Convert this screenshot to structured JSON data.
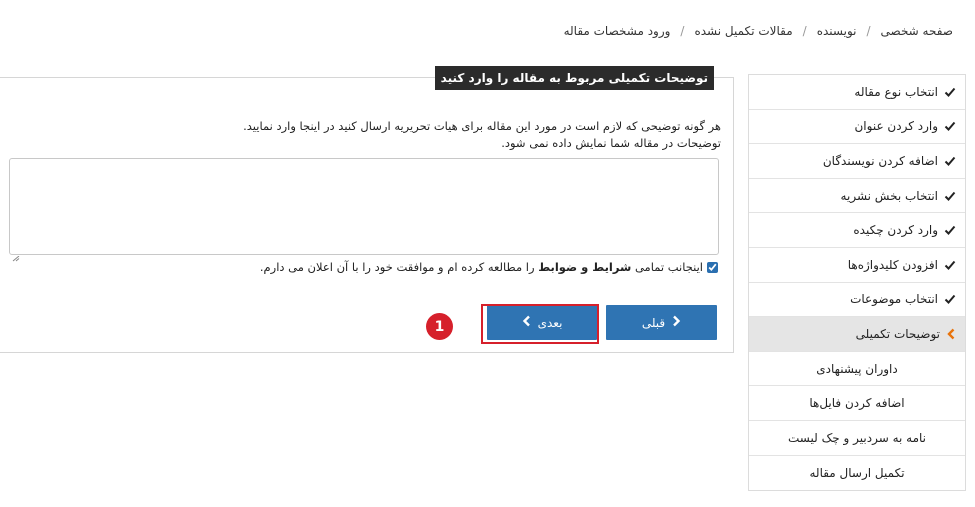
{
  "breadcrumb": [
    "صفحه شخصی",
    "نویسنده",
    "مقالات تکمیل نشده",
    "ورود مشخصات مقاله"
  ],
  "sidebar": {
    "items": [
      {
        "label": "انتخاب نوع مقاله",
        "state": "done"
      },
      {
        "label": "وارد کردن عنوان",
        "state": "done"
      },
      {
        "label": "اضافه کردن نویسندگان",
        "state": "done"
      },
      {
        "label": "انتخاب بخش نشریه",
        "state": "done"
      },
      {
        "label": "وارد کردن چکیده",
        "state": "done"
      },
      {
        "label": "افزودن کلیدواژه‌ها",
        "state": "done"
      },
      {
        "label": "انتخاب موضوعات",
        "state": "done"
      },
      {
        "label": "توضیحات تکمیلی",
        "state": "active"
      },
      {
        "label": "داوران پیشنهادی",
        "state": "pending"
      },
      {
        "label": "اضافه کردن فایل‌ها",
        "state": "pending"
      },
      {
        "label": "نامه به سردبیر و چک لیست",
        "state": "pending"
      },
      {
        "label": "تکمیل ارسال مقاله",
        "state": "pending"
      }
    ]
  },
  "panel": {
    "legend": "توضیحات تکمیلی مربوط به مقاله را وارد کنید",
    "description_line1": "هر گونه توضیحی که لازم است در مورد این مقاله برای هیات تحریریه ارسال کنید در اینجا وارد نمایید.",
    "description_line2": "توضیحات در مقاله شما نمایش داده نمی شود.",
    "textarea_value": "",
    "agree_prefix": "اینجانب تمامی",
    "agree_bold": "شرایط و ضوابط",
    "agree_suffix": "را مطالعه کرده ام و موافقت خود را با آن اعلان می دارم.",
    "agree_checked": true
  },
  "buttons": {
    "prev_label": "قبلی",
    "next_label": "بعدی"
  },
  "annotation": {
    "badge_number": "1"
  },
  "colors": {
    "primary": "#2f74b3",
    "highlight": "#d6202b",
    "legend_bg": "#2b2b2b",
    "active_bg": "#e5e5e5",
    "active_arrow": "#e8730c"
  }
}
